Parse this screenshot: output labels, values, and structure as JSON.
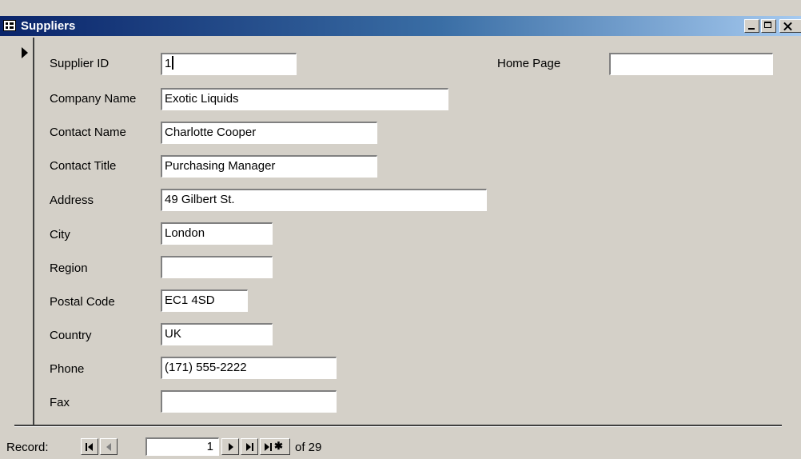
{
  "window": {
    "title": "Suppliers"
  },
  "fields": [
    {
      "label": "Supplier ID",
      "value": "1"
    },
    {
      "label": "Company Name",
      "value": "Exotic Liquids"
    },
    {
      "label": "Contact Name",
      "value": "Charlotte Cooper"
    },
    {
      "label": "Contact Title",
      "value": "Purchasing Manager"
    },
    {
      "label": "Address",
      "value": "49 Gilbert St."
    },
    {
      "label": "City",
      "value": "London"
    },
    {
      "label": "Region",
      "value": ""
    },
    {
      "label": "Postal Code",
      "value": "EC1 4SD"
    },
    {
      "label": "Country",
      "value": "UK"
    },
    {
      "label": "Phone",
      "value": "(171) 555-2222"
    },
    {
      "label": "Fax",
      "value": ""
    },
    {
      "label": "Home Page",
      "value": ""
    }
  ],
  "navigation": {
    "label": "Record:",
    "current": "1",
    "total_text": "of  29"
  },
  "icons": {
    "window_icon": "form-icon",
    "minimize": "minimize-icon",
    "maximize": "maximize-icon",
    "close": "close-icon"
  },
  "colors": {
    "titlebar_start": "#0a246a",
    "titlebar_end": "#a6caf0",
    "face": "#d4d0c8"
  }
}
